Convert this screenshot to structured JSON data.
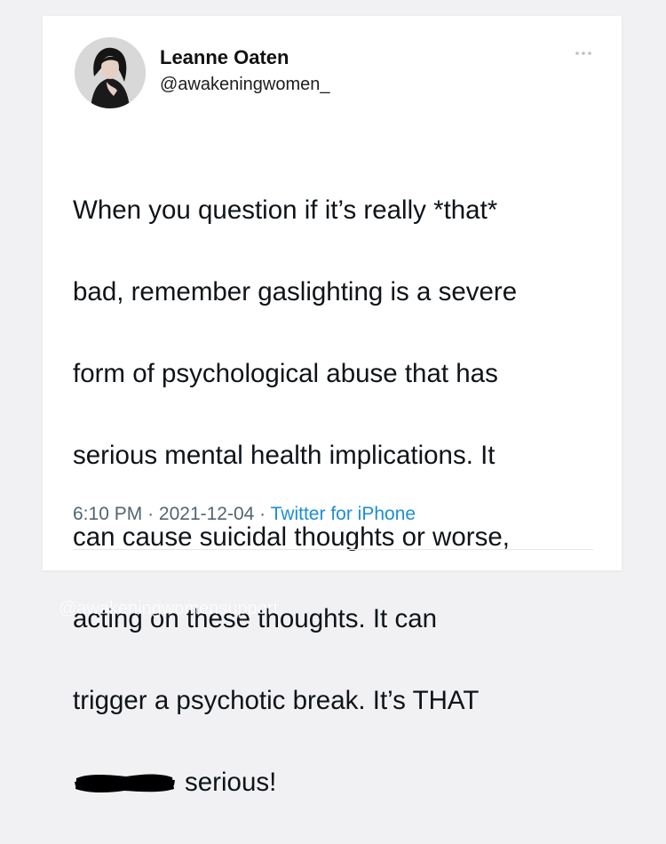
{
  "tweet": {
    "author_name": "Leanne Oaten",
    "author_handle": "@awakeningwomen_",
    "more_icon": "more-horizontal-icon",
    "lines": [
      "When you question if it’s really *that*",
      "bad, remember gaslighting is a severe",
      "form of psychological abuse that has",
      "serious mental health implications. It",
      "can cause suicidal thoughts or worse,",
      "acting on these thoughts. It can",
      "trigger a psychotic break. It’s THAT"
    ],
    "last_line_after_redaction": "serious!",
    "time": "6:10 PM",
    "separator": "·",
    "date": "2021-12-04",
    "source": "Twitter for iPhone"
  },
  "watermark": "@awakeningwomensupport",
  "colors": {
    "background": "#f1f1f3",
    "card": "#ffffff",
    "text": "#0f1419",
    "meta": "#536471",
    "link": "#1d8ed6"
  }
}
